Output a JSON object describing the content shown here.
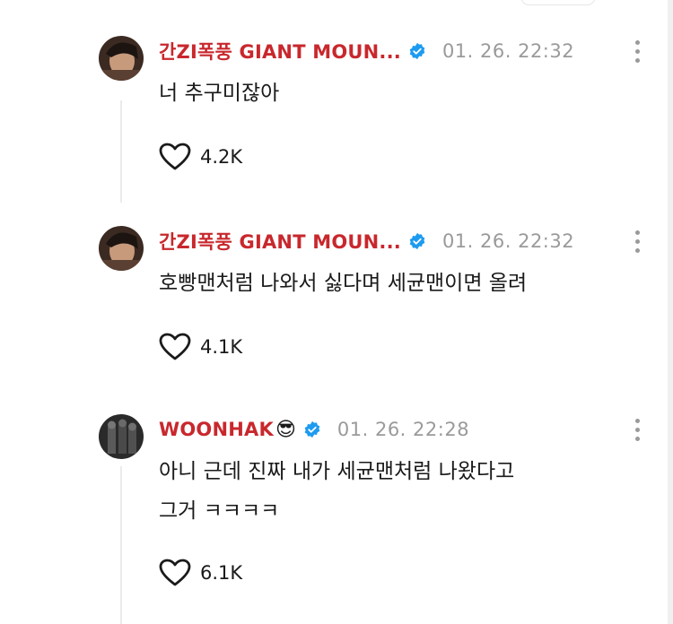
{
  "colors": {
    "brand_red": "#c8282d",
    "verified_blue": "#1d9bf0",
    "meta_gray": "#9a9a9a"
  },
  "comments": [
    {
      "username": "간ZI폭풍 GIANT MOUN...",
      "username_color": "#c8282d",
      "emoji": "",
      "verified": true,
      "timestamp": "01. 26. 22:32",
      "text_lines": [
        "너 추구미잖아"
      ],
      "likes": "4.2K"
    },
    {
      "username": "간ZI폭풍 GIANT MOUN...",
      "username_color": "#c8282d",
      "emoji": "",
      "verified": true,
      "timestamp": "01. 26. 22:32",
      "text_lines": [
        "호빵맨처럼 나와서 싫다며 세균맨이면 올려"
      ],
      "likes": "4.1K"
    },
    {
      "username": "WOONHAK",
      "username_color": "#c8282d",
      "emoji": "😎",
      "verified": true,
      "timestamp": "01. 26. 22:28",
      "text_lines": [
        "아니 근데 진짜 내가 세균맨처럼 나왔다고",
        "그거 ㅋㅋㅋㅋ"
      ],
      "likes": "6.1K"
    }
  ]
}
